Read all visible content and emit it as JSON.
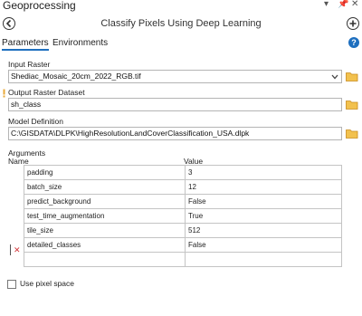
{
  "window": {
    "title": "Geoprocessing",
    "pin": "— p ×"
  },
  "tool": {
    "title": "Classify Pixels Using Deep Learning"
  },
  "tabs": [
    {
      "label": "Parameters",
      "active": true
    },
    {
      "label": "Environments",
      "active": false
    }
  ],
  "params": {
    "input_raster": {
      "label": "Input Raster",
      "value": "Shediac_Mosaic_20cm_2022_RGB.tif"
    },
    "output_raster": {
      "label": "Output Raster Dataset",
      "value": "sh_class"
    },
    "model": {
      "label": "Model Definition",
      "value": "C:\\GISDATA\\DLPK\\HighResolutionLandCoverClassification_USA.dlpk"
    }
  },
  "arguments": {
    "section_label": "Arguments",
    "col_name": "Name",
    "col_value": "Value",
    "rows": [
      {
        "name": "padding",
        "value": "3"
      },
      {
        "name": "batch_size",
        "value": "12"
      },
      {
        "name": "predict_background",
        "value": "False"
      },
      {
        "name": "test_time_augmentation",
        "value": "True"
      },
      {
        "name": "tile_size",
        "value": "512"
      },
      {
        "name": "detailed_classes",
        "value": "False"
      },
      {
        "name": "",
        "value": ""
      }
    ]
  },
  "options": {
    "pixel_space_label": "Use pixel space",
    "pixel_space_checked": false
  },
  "colors": {
    "accent": "#1e6fbf",
    "folder": "#e8a93a",
    "error": "#d13438"
  },
  "icons": [
    "back-icon",
    "add-icon",
    "help-icon",
    "folder-icon",
    "chevron-down-icon",
    "warning-icon",
    "delete-icon"
  ]
}
